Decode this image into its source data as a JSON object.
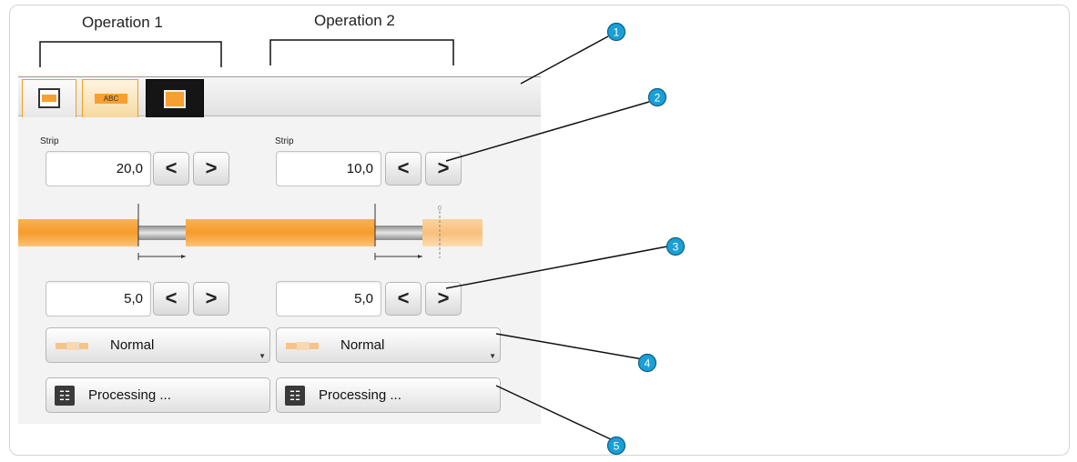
{
  "operations": [
    "Operation 1",
    "Operation 2"
  ],
  "callouts": [
    "1",
    "2",
    "3",
    "4",
    "5"
  ],
  "tabs": {
    "abc_label": "ABC"
  },
  "op1": {
    "strip_label": "Strip",
    "strip_value": "20,0",
    "second_value": "5,0",
    "mode_label": "Normal",
    "processing_label": "Processing ..."
  },
  "op2": {
    "strip_label": "Strip",
    "strip_value": "10,0",
    "second_value": "5,0",
    "mode_label": "Normal",
    "processing_label": "Processing ..."
  },
  "buttons": {
    "prev_glyph": "<",
    "next_glyph": ">"
  },
  "diagram": {
    "zero_marker": "0"
  },
  "colors": {
    "accent": "#f5a030",
    "callout": "#1a9fd6"
  }
}
